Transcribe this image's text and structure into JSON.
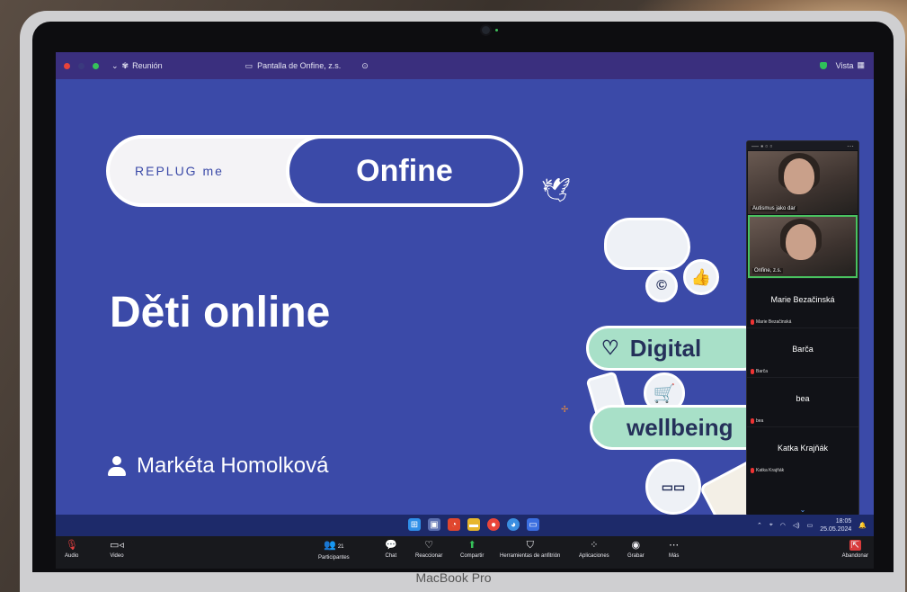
{
  "device": {
    "brand": "MacBook Pro"
  },
  "zoom_titlebar": {
    "meeting_label": "Reunión",
    "share_label": "Pantalla de Onfine, z.s.",
    "view_label": "Vista"
  },
  "slide": {
    "logo_left": "REPLUG me",
    "logo_right": "Onfine",
    "title": "Děti online",
    "presenter": "Markéta Homolková",
    "tag_digital": "Digital",
    "tag_wellbeing": "wellbeing"
  },
  "participants_panel": {
    "video_tiles": [
      {
        "name": "Autismus jako dar"
      },
      {
        "name": "Onfine, z.s."
      }
    ],
    "tiles": [
      {
        "big": "Marie Bezačinská",
        "small": "Marie Bezačinská"
      },
      {
        "big": "Barča",
        "small": "Barča"
      },
      {
        "big": "bea",
        "small": "bea"
      },
      {
        "big": "Katka Krajňák",
        "small": "Katka Krajňák"
      }
    ]
  },
  "taskbar": {
    "time": "18:05",
    "date": "25.05.2024"
  },
  "toolbar": {
    "audio": "Audio",
    "video": "Video",
    "participants": "Participantes",
    "participants_count": "21",
    "chat": "Chat",
    "react": "Reaccionar",
    "share": "Compartir",
    "host_tools": "Herramientas de anfitrión",
    "apps": "Aplicaciones",
    "record": "Grabar",
    "more": "Más",
    "leave": "Abandonar"
  },
  "colors": {
    "slide_bg": "#3b4aa8",
    "tag_green": "#a8e0c8",
    "zoom_bar": "#18191d",
    "active_speaker": "#49c25f",
    "leave_red": "#d83b3b"
  }
}
